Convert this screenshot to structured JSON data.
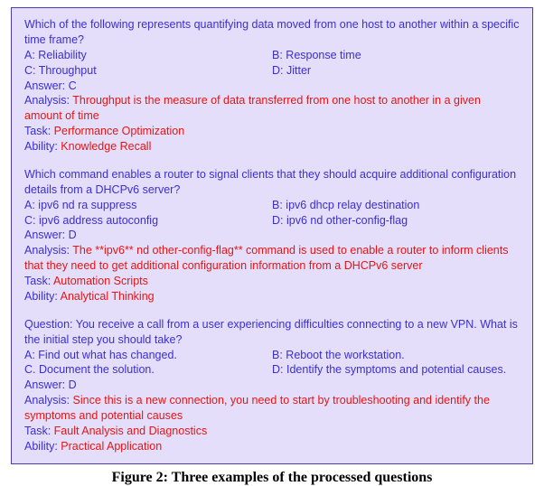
{
  "caption": "Figure 2: Three examples of the processed questions",
  "questions": [
    {
      "prompt_prefix": "",
      "prompt": "Which of the following represents quantifying data moved from one host to another within a specific time frame?",
      "optA_label": "A: ",
      "optA": "Reliability",
      "optB_label": "B: ",
      "optB": "Response time",
      "optC_label": "C: ",
      "optC": "Throughput",
      "optD_label": "D: ",
      "optD": "Jitter",
      "answer_label": "Answer: ",
      "answer": "C",
      "analysis_label": "Analysis: ",
      "analysis": "Throughput is the measure of data transferred from one host to another in a given amount of time",
      "task_label": "Task: ",
      "task": "Performance Optimization",
      "ability_label": "Ability: ",
      "ability": "Knowledge Recall"
    },
    {
      "prompt_prefix": "",
      "prompt": "Which command enables a router to signal clients that they should acquire additional configuration details from a DHCPv6 server?",
      "optA_label": "A: ",
      "optA": "ipv6 nd ra suppress",
      "optB_label": "B: ",
      "optB": "ipv6 dhcp relay destination",
      "optC_label": "C: ",
      "optC": "ipv6 address autoconfig",
      "optD_label": "D: ",
      "optD": "ipv6 nd other-config-flag",
      "answer_label": "Answer: ",
      "answer": "D",
      "analysis_label": "Analysis: ",
      "analysis": "The **ipv6** nd other-config-flag** command is used to enable a router to inform clients that they need to get additional configuration information from a DHCPv6 server",
      "task_label": "Task: ",
      "task": "Automation Scripts",
      "ability_label": "Ability: ",
      "ability": "Analytical Thinking"
    },
    {
      "prompt_prefix": "Question: ",
      "prompt": "You receive a call from a user experiencing difficulties connecting to a new VPN. What is the initial step you should take?",
      "optA_label": "A: ",
      "optA": "Find out what has changed.",
      "optB_label": "B: ",
      "optB": "Reboot the workstation.",
      "optC_label": "C. ",
      "optC": "Document the solution.",
      "optD_label": "D: ",
      "optD": "Identify the symptoms and potential causes.",
      "answer_label": "Answer: ",
      "answer": "D",
      "analysis_label": "Analysis: ",
      "analysis": "Since this is a new connection, you need to start by troubleshooting and identify the symptoms and potential causes",
      "task_label": "Task: ",
      "task": "Fault Analysis and Diagnostics",
      "ability_label": "Ability: ",
      "ability": "Practical Application"
    }
  ]
}
